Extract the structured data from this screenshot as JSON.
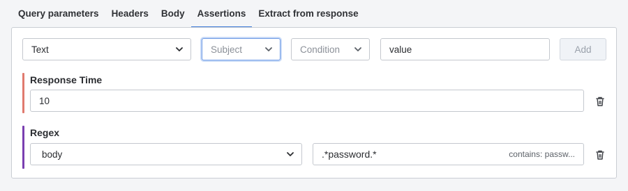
{
  "tabs": [
    {
      "label": "Query parameters"
    },
    {
      "label": "Headers"
    },
    {
      "label": "Body"
    },
    {
      "label": "Assertions",
      "active": true
    },
    {
      "label": "Extract from response"
    }
  ],
  "form": {
    "type_value": "Text",
    "subject_placeholder": "Subject",
    "condition_placeholder": "Condition",
    "value_text": "value",
    "add_label": "Add"
  },
  "assertions": [
    {
      "title": "Response Time",
      "color": "#e07a6e",
      "value": "10"
    },
    {
      "title": "Regex",
      "color": "#7a3fb0",
      "subject": "body",
      "pattern": ".*password.*",
      "hint": "contains: passw..."
    }
  ],
  "colors": {
    "active_tab": "#3d7bd9"
  }
}
